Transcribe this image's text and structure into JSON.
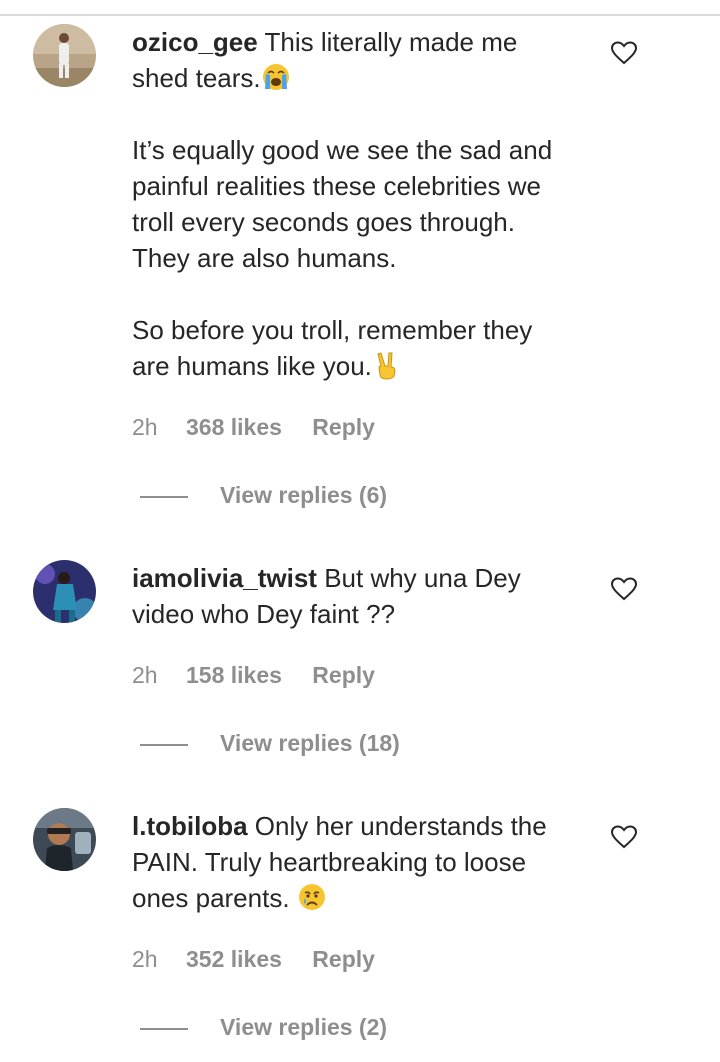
{
  "comments": [
    {
      "username": "ozico_gee",
      "text_line1": " This literally made me",
      "text_line2": "shed tears.",
      "text_para2": "It’s equally good we see the sad and\npainful realities these celebrities we\ntroll every seconds goes through.\nThey are also humans.",
      "text_para3": "So before you troll, remember they\nare humans like you.",
      "emoji1": "loudly-crying-face",
      "emoji2": "victory-hand",
      "time": "2h",
      "likes": "368 likes",
      "reply": "Reply",
      "view_replies": "View replies (6)"
    },
    {
      "username": "iamolivia_twist",
      "text_line1": " But why una Dey",
      "text_line2": "video who Dey faint ??",
      "time": "2h",
      "likes": "158 likes",
      "reply": "Reply",
      "view_replies": "View replies (18)"
    },
    {
      "username": "l.tobiloba",
      "text_line1": " Only her understands the",
      "text_line2": "PAIN. Truly heartbreaking to loose",
      "text_line3": "ones parents. ",
      "emoji1": "crying-face",
      "time": "2h",
      "likes": "352 likes",
      "reply": "Reply",
      "view_replies": "View replies (2)"
    }
  ],
  "colors": {
    "text": "#262626",
    "secondary": "#8e8e8e",
    "divider": "#dbdbdb"
  }
}
